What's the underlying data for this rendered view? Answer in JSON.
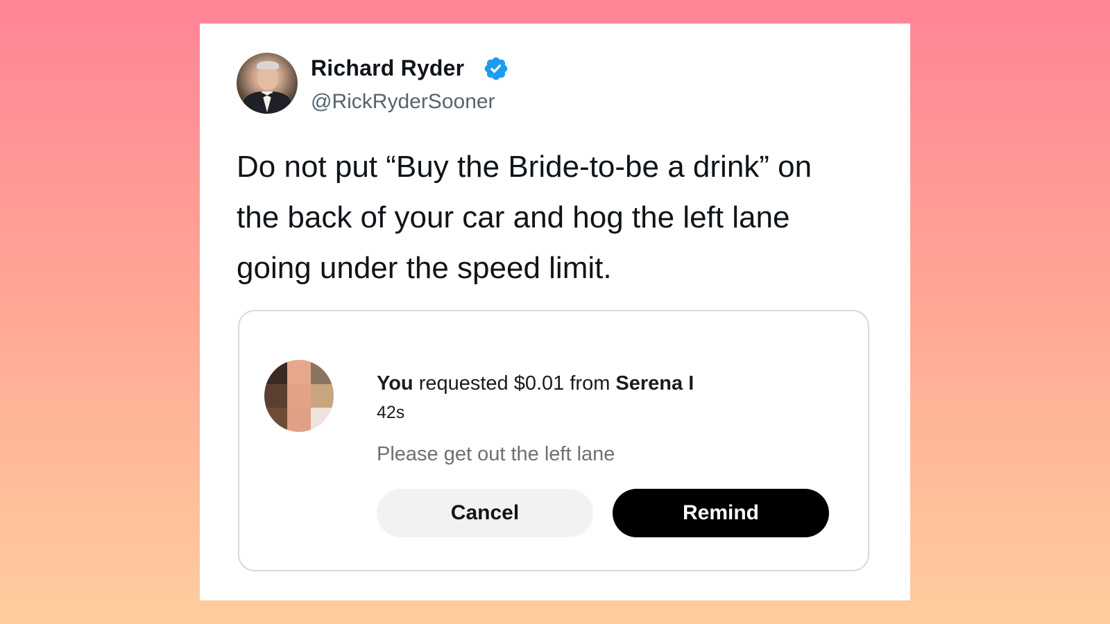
{
  "tweet": {
    "author_name": "Richard Ryder",
    "handle": "@RickRyderSooner",
    "verified": true,
    "text": "Do not put “Buy the Bride-to-be a drink” on the back of your car and hog the left lane going under the speed limit."
  },
  "payment_request": {
    "actor": "You",
    "action": "requested $0.01 from",
    "recipient": "Serena I",
    "time_ago": "42s",
    "note": "Please get out the left lane",
    "cancel_label": "Cancel",
    "remind_label": "Remind"
  },
  "colors": {
    "verified_badge": "#1d9bf0",
    "remind_button": "#000000",
    "cancel_button": "#f1f2f4",
    "background_top": "#ff8497",
    "background_bottom": "#ffcd9f"
  },
  "icons": {
    "verified": "verified-badge-icon"
  }
}
